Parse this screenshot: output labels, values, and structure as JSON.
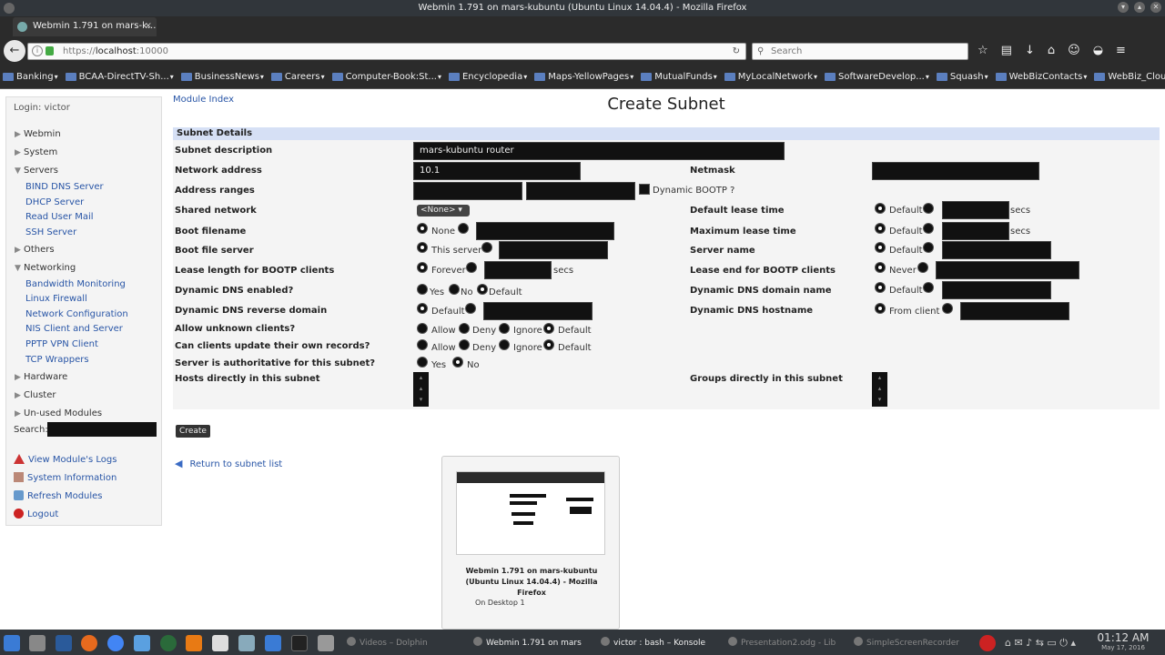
{
  "window": {
    "title": "Webmin 1.791 on mars-kubuntu (Ubuntu Linux 14.04.4) - Mozilla Firefox"
  },
  "browser": {
    "tab_title": "Webmin 1.791 on mars-k...",
    "tab_close": "×",
    "new_tab": "+",
    "url_prefix": "https://",
    "url_host": "localhost",
    "url_port": ":10000",
    "search_placeholder": "Search",
    "bookmarks": [
      "Banking",
      "BCAA-DirectTV-Sh...",
      "BusinessNews",
      "Careers",
      "Computer-Book:St...",
      "Encyclopedia",
      "Maps-YellowPages",
      "MutualFunds",
      "MyLocalNetwork",
      "SoftwareDevelop...",
      "Squash",
      "WebBizContacts",
      "WebBiz_Cloud"
    ]
  },
  "sidebar": {
    "login": "Login: victor",
    "categories": {
      "webmin": "Webmin",
      "system": "System",
      "servers": "Servers",
      "others": "Others",
      "networking": "Networking",
      "hardware": "Hardware",
      "cluster": "Cluster",
      "unused": "Un-used Modules"
    },
    "servers_items": [
      "BIND DNS Server",
      "DHCP Server",
      "Read User Mail",
      "SSH Server"
    ],
    "networking_items": [
      "Bandwidth Monitoring",
      "Linux Firewall",
      "Network Configuration",
      "NIS Client and Server",
      "PPTP VPN Client",
      "TCP Wrappers"
    ],
    "search_label": "Search:",
    "links": [
      "View Module's Logs",
      "System Information",
      "Refresh Modules",
      "Logout"
    ]
  },
  "page": {
    "module_index": "Module Index",
    "title": "Create Subnet",
    "section": "Subnet Details",
    "labels": {
      "subnet_description": "Subnet description",
      "network_address": "Network address",
      "netmask": "Netmask",
      "address_ranges": "Address ranges",
      "dynamic_bootp": "Dynamic BOOTP ?",
      "shared_network": "Shared network",
      "default_lease_time": "Default lease time",
      "boot_filename": "Boot filename",
      "max_lease_time": "Maximum lease time",
      "boot_file_server": "Boot file server",
      "server_name": "Server name",
      "lease_length_bootp": "Lease length for BOOTP clients",
      "lease_end_bootp": "Lease end for BOOTP clients",
      "ddns_enabled": "Dynamic DNS enabled?",
      "ddns_domain": "Dynamic DNS domain name",
      "ddns_reverse": "Dynamic DNS reverse domain",
      "ddns_hostname": "Dynamic DNS hostname",
      "allow_unknown": "Allow unknown clients?",
      "clients_update": "Can clients update their own records?",
      "authoritative": "Server is authoritative for this subnet?",
      "hosts_in_subnet": "Hosts directly in this subnet",
      "groups_in_subnet": "Groups directly in this subnet"
    },
    "values": {
      "subnet_description": "mars-kubuntu router",
      "network_address": "10.1",
      "shared_network": "<None>"
    },
    "options": {
      "default": "Default",
      "none": "None",
      "this_server": "This server",
      "forever": "Forever",
      "never": "Never",
      "yes": "Yes",
      "no": "No",
      "from_client": "From client",
      "allow": "Allow",
      "deny": "Deny",
      "ignore": "Ignore",
      "secs": "secs"
    },
    "create_button": "Create",
    "return_link": "Return to subnet list"
  },
  "tooltip": {
    "title": "Webmin 1.791 on mars-kubuntu (Ubuntu Linux 14.04.4) - Mozilla Firefox",
    "subtitle": "On Desktop 1"
  },
  "taskbar": {
    "tasks": [
      "Videos – Dolphin",
      "Webmin 1.791 on mars",
      "victor : bash – Konsole",
      "Presentation2.odg - Lib",
      "SimpleScreenRecorder"
    ],
    "time": "01:12 AM",
    "date": "May 17, 2016"
  }
}
